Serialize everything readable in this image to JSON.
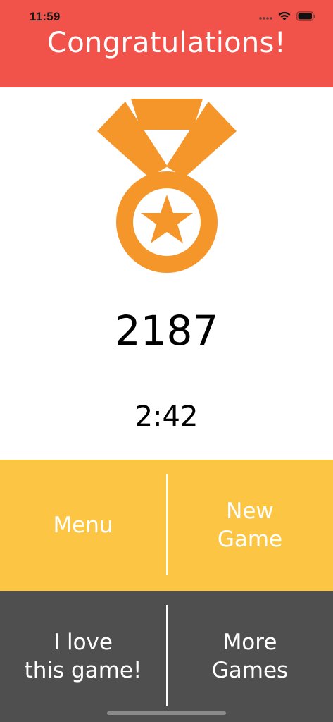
{
  "status_bar": {
    "time": "11:59"
  },
  "header": {
    "title": "Congratulations!"
  },
  "result": {
    "score": "2187",
    "time": "2:42"
  },
  "buttons": {
    "menu": "Menu",
    "new_game": "New\nGame",
    "love_game": "I love\nthis game!",
    "more_games": "More\nGames"
  },
  "icons": [
    "wifi-icon",
    "battery-icon",
    "signal-dots-icon",
    "medal-icon",
    "star-icon"
  ],
  "colors": {
    "header": "#f15249",
    "medal": "#f5962b",
    "button_row_primary": "#fcc544",
    "button_row_secondary": "#4f4f4f"
  }
}
